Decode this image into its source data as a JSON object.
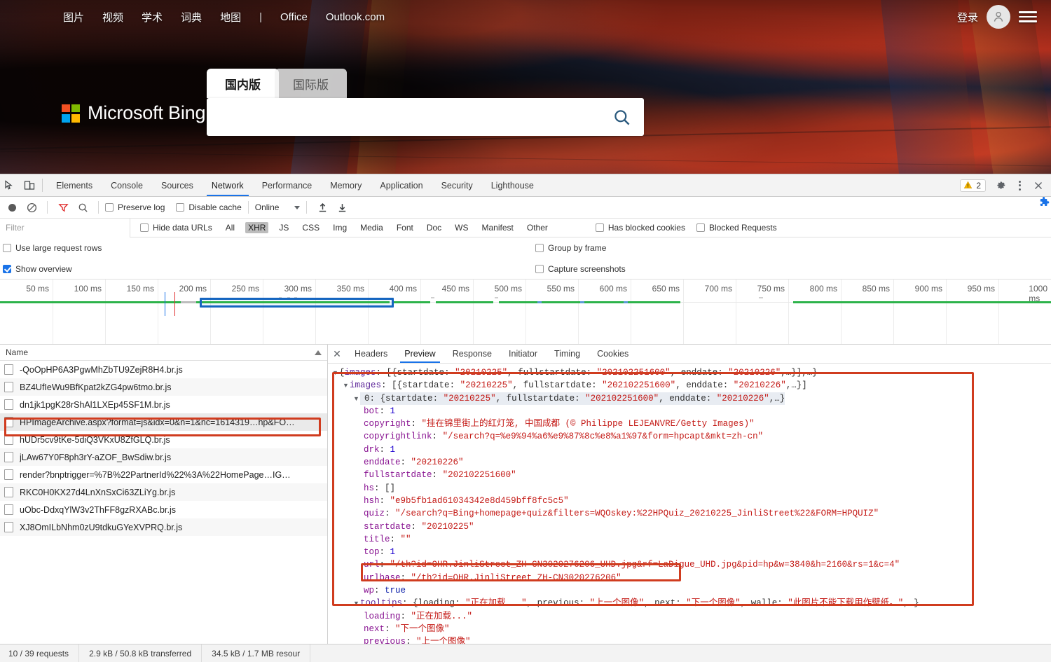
{
  "bing": {
    "nav_items": [
      "图片",
      "视频",
      "学术",
      "词典",
      "地图"
    ],
    "nav_separator": "|",
    "nav_office": "Office",
    "nav_outlook": "Outlook.com",
    "signin_label": "登录",
    "logo_text": "Microsoft Bing",
    "logo_colors": [
      "#f25022",
      "#7fba00",
      "#00a4ef",
      "#ffb900"
    ],
    "tabs": [
      {
        "label": "国内版",
        "active": true
      },
      {
        "label": "国际版",
        "active": false
      }
    ],
    "search_value": "",
    "search_placeholder": "",
    "search_icon": "search-icon"
  },
  "devtools": {
    "panels": [
      "Elements",
      "Console",
      "Sources",
      "Network",
      "Performance",
      "Memory",
      "Application",
      "Security",
      "Lighthouse"
    ],
    "active_panel": "Network",
    "warning_count": "2",
    "toolbar": {
      "preserve_log": {
        "label": "Preserve log",
        "checked": false
      },
      "disable_cache": {
        "label": "Disable cache",
        "checked": false
      },
      "throttle_value": "Online"
    },
    "filter": {
      "placeholder": "Filter",
      "value": "",
      "hide_data_urls": {
        "label": "Hide data URLs",
        "checked": false
      },
      "types": [
        "All",
        "XHR",
        "JS",
        "CSS",
        "Img",
        "Media",
        "Font",
        "Doc",
        "WS",
        "Manifest",
        "Other"
      ],
      "selected_type": "XHR",
      "has_blocked_cookies": {
        "label": "Has blocked cookies",
        "checked": false
      },
      "blocked_requests": {
        "label": "Blocked Requests",
        "checked": false
      }
    },
    "options": {
      "use_large_request_rows": {
        "label": "Use large request rows",
        "checked": false
      },
      "show_overview": {
        "label": "Show overview",
        "checked": true
      },
      "group_by_frame": {
        "label": "Group by frame",
        "checked": false
      },
      "capture_screenshots": {
        "label": "Capture screenshots",
        "checked": false
      }
    },
    "overview": {
      "ticks": [
        "50 ms",
        "100 ms",
        "150 ms",
        "200 ms",
        "250 ms",
        "300 ms",
        "350 ms",
        "400 ms",
        "450 ms",
        "500 ms",
        "550 ms",
        "600 ms",
        "650 ms",
        "700 ms",
        "750 ms",
        "800 ms",
        "850 ms",
        "900 ms",
        "950 ms",
        "1000 ms"
      ],
      "selection_start_ms": 205,
      "selection_end_ms": 405
    },
    "requests": {
      "column_header": "Name",
      "rows": [
        {
          "name": "-QoOpHP6A3PgwMhZbTU9ZejR8H4.br.js",
          "selected": false
        },
        {
          "name": "BZ4UfIeWu9BfKpat2kZG4pw6tmo.br.js",
          "selected": false
        },
        {
          "name": "dn1jk1pgK28rShAl1LXEp45SF1M.br.js",
          "selected": false
        },
        {
          "name": "HPImageArchive.aspx?format=js&idx=0&n=1&nc=1614319…hp&FO…",
          "selected": true
        },
        {
          "name": "hUDr5cv9tKe-5diQ3VKxU8ZfGLQ.br.js",
          "selected": false
        },
        {
          "name": "jLAw67Y0F8ph3rY-aZOF_BwSdiw.br.js",
          "selected": false
        },
        {
          "name": "render?bnptrigger=%7B%22PartnerId%22%3A%22HomePage…IG…",
          "selected": false
        },
        {
          "name": "RKC0H0KX27d4LnXnSxCi63ZLiYg.br.js",
          "selected": false
        },
        {
          "name": "uObc-DdxqYlW3v2ThFF8gzRXABc.br.js",
          "selected": false
        },
        {
          "name": "XJ8OmILbNhm0zU9tdkuGYeXVPRQ.br.js",
          "selected": false
        }
      ]
    },
    "detail": {
      "tabs": [
        "Headers",
        "Preview",
        "Response",
        "Initiator",
        "Timing",
        "Cookies"
      ],
      "active_tab": "Preview",
      "close_icon": "close-icon"
    },
    "statusbar": {
      "requests": "10 / 39 requests",
      "transferred": "2.9 kB / 50.8 kB transferred",
      "resources": "34.5 kB / 1.7 MB resour"
    },
    "highlight_color": "#d03c1f"
  },
  "preview_json": {
    "lines": [
      {
        "indent": 0,
        "tri": "▼",
        "parts": [
          {
            "t": "{",
            "c": "p"
          },
          {
            "t": "images",
            "c": "k2"
          },
          {
            "t": ": [{",
            "c": "p"
          },
          {
            "t": "startdate",
            "c": "p"
          },
          {
            "t": ": ",
            "c": "p"
          },
          {
            "t": "\"20210225\"",
            "c": "s"
          },
          {
            "t": ", ",
            "c": "p"
          },
          {
            "t": "fullstartdate",
            "c": "p"
          },
          {
            "t": ": ",
            "c": "p"
          },
          {
            "t": "\"202102251600\"",
            "c": "s"
          },
          {
            "t": ", ",
            "c": "p"
          },
          {
            "t": "enddate",
            "c": "p"
          },
          {
            "t": ": ",
            "c": "p"
          },
          {
            "t": "\"20210226\"",
            "c": "s"
          },
          {
            "t": ",…}],…}",
            "c": "p"
          }
        ]
      },
      {
        "indent": 1,
        "tri": "▼",
        "parts": [
          {
            "t": "images",
            "c": "k2"
          },
          {
            "t": ": [{",
            "c": "p"
          },
          {
            "t": "startdate",
            "c": "p"
          },
          {
            "t": ": ",
            "c": "p"
          },
          {
            "t": "\"20210225\"",
            "c": "s"
          },
          {
            "t": ", ",
            "c": "p"
          },
          {
            "t": "fullstartdate",
            "c": "p"
          },
          {
            "t": ": ",
            "c": "p"
          },
          {
            "t": "\"202102251600\"",
            "c": "s"
          },
          {
            "t": ", ",
            "c": "p"
          },
          {
            "t": "enddate",
            "c": "p"
          },
          {
            "t": ": ",
            "c": "p"
          },
          {
            "t": "\"20210226\"",
            "c": "s"
          },
          {
            "t": ",…}]",
            "c": "p"
          }
        ]
      },
      {
        "indent": 2,
        "tri": "▼",
        "hl": true,
        "parts": [
          {
            "t": "0",
            "c": "p"
          },
          {
            "t": ": {",
            "c": "p"
          },
          {
            "t": "startdate",
            "c": "p"
          },
          {
            "t": ": ",
            "c": "p"
          },
          {
            "t": "\"20210225\"",
            "c": "s"
          },
          {
            "t": ", ",
            "c": "p"
          },
          {
            "t": "fullstartdate",
            "c": "p"
          },
          {
            "t": ": ",
            "c": "p"
          },
          {
            "t": "\"202102251600\"",
            "c": "s"
          },
          {
            "t": ", ",
            "c": "p"
          },
          {
            "t": "enddate",
            "c": "p"
          },
          {
            "t": ": ",
            "c": "p"
          },
          {
            "t": "\"20210226\"",
            "c": "s"
          },
          {
            "t": ",…}",
            "c": "p"
          }
        ]
      },
      {
        "indent": 3,
        "parts": [
          {
            "t": "bot",
            "c": "k"
          },
          {
            "t": ": ",
            "c": "p"
          },
          {
            "t": "1",
            "c": "n"
          }
        ]
      },
      {
        "indent": 3,
        "parts": [
          {
            "t": "copyright",
            "c": "k"
          },
          {
            "t": ": ",
            "c": "p"
          },
          {
            "t": "\"挂在锦里街上的红灯笼, 中国成都 (© Philippe LEJEANVRE/Getty Images)\"",
            "c": "s"
          }
        ]
      },
      {
        "indent": 3,
        "parts": [
          {
            "t": "copyrightlink",
            "c": "k"
          },
          {
            "t": ": ",
            "c": "p"
          },
          {
            "t": "\"/search?q=%e9%94%a6%e9%87%8c%e8%a1%97&form=hpcapt&mkt=zh-cn\"",
            "c": "s"
          }
        ]
      },
      {
        "indent": 3,
        "parts": [
          {
            "t": "drk",
            "c": "k"
          },
          {
            "t": ": ",
            "c": "p"
          },
          {
            "t": "1",
            "c": "n"
          }
        ]
      },
      {
        "indent": 3,
        "parts": [
          {
            "t": "enddate",
            "c": "k"
          },
          {
            "t": ": ",
            "c": "p"
          },
          {
            "t": "\"20210226\"",
            "c": "s"
          }
        ]
      },
      {
        "indent": 3,
        "parts": [
          {
            "t": "fullstartdate",
            "c": "k"
          },
          {
            "t": ": ",
            "c": "p"
          },
          {
            "t": "\"202102251600\"",
            "c": "s"
          }
        ]
      },
      {
        "indent": 3,
        "parts": [
          {
            "t": "hs",
            "c": "k"
          },
          {
            "t": ": []",
            "c": "p"
          }
        ]
      },
      {
        "indent": 3,
        "parts": [
          {
            "t": "hsh",
            "c": "k"
          },
          {
            "t": ": ",
            "c": "p"
          },
          {
            "t": "\"e9b5fb1ad61034342e8d459bff8fc5c5\"",
            "c": "s"
          }
        ]
      },
      {
        "indent": 3,
        "parts": [
          {
            "t": "quiz",
            "c": "k"
          },
          {
            "t": ": ",
            "c": "p"
          },
          {
            "t": "\"/search?q=Bing+homepage+quiz&filters=WQOskey:%22HPQuiz_20210225_JinliStreet%22&FORM=HPQUIZ\"",
            "c": "s"
          }
        ]
      },
      {
        "indent": 3,
        "parts": [
          {
            "t": "startdate",
            "c": "k"
          },
          {
            "t": ": ",
            "c": "p"
          },
          {
            "t": "\"20210225\"",
            "c": "s"
          }
        ]
      },
      {
        "indent": 3,
        "parts": [
          {
            "t": "title",
            "c": "k"
          },
          {
            "t": ": ",
            "c": "p"
          },
          {
            "t": "\"\"",
            "c": "s"
          }
        ]
      },
      {
        "indent": 3,
        "parts": [
          {
            "t": "top",
            "c": "k"
          },
          {
            "t": ": ",
            "c": "p"
          },
          {
            "t": "1",
            "c": "n"
          }
        ]
      },
      {
        "indent": 3,
        "box": true,
        "parts": [
          {
            "t": "url",
            "c": "k"
          },
          {
            "t": ": ",
            "c": "p"
          },
          {
            "t": "\"/th?id=OHR.JinliStreet_ZH-CN3020276206_UHD.jpg&rf=LaDigue_UHD.jpg&pid=hp&w=3840&h=2160&rs=1&c=4\"",
            "c": "s"
          }
        ]
      },
      {
        "indent": 3,
        "parts": [
          {
            "t": "urlbase",
            "c": "k"
          },
          {
            "t": ": ",
            "c": "p"
          },
          {
            "t": "\"/th?id=OHR.JinliStreet_ZH-CN3020276206\"",
            "c": "s"
          }
        ]
      },
      {
        "indent": 3,
        "parts": [
          {
            "t": "wp",
            "c": "k"
          },
          {
            "t": ": ",
            "c": "p"
          },
          {
            "t": "true",
            "c": "b"
          }
        ]
      },
      {
        "indent": 2,
        "tri": "▼",
        "parts": [
          {
            "t": "tooltips",
            "c": "k2"
          },
          {
            "t": ": {",
            "c": "p"
          },
          {
            "t": "loading",
            "c": "p"
          },
          {
            "t": ": ",
            "c": "p"
          },
          {
            "t": "\"正在加载...\"",
            "c": "s"
          },
          {
            "t": ", ",
            "c": "p"
          },
          {
            "t": "previous",
            "c": "p"
          },
          {
            "t": ": ",
            "c": "p"
          },
          {
            "t": "\"上一个图像\"",
            "c": "s"
          },
          {
            "t": ", ",
            "c": "p"
          },
          {
            "t": "next",
            "c": "p"
          },
          {
            "t": ": ",
            "c": "p"
          },
          {
            "t": "\"下一个图像\"",
            "c": "s"
          },
          {
            "t": ", ",
            "c": "p"
          },
          {
            "t": "walle",
            "c": "p"
          },
          {
            "t": ": ",
            "c": "p"
          },
          {
            "t": "\"此图片不能下载用作壁纸。\"",
            "c": "s"
          },
          {
            "t": ",…}",
            "c": "p"
          }
        ]
      },
      {
        "indent": 3,
        "parts": [
          {
            "t": "loading",
            "c": "k"
          },
          {
            "t": ": ",
            "c": "p"
          },
          {
            "t": "\"正在加载...\"",
            "c": "s"
          }
        ]
      },
      {
        "indent": 3,
        "parts": [
          {
            "t": "next",
            "c": "k"
          },
          {
            "t": ": ",
            "c": "p"
          },
          {
            "t": "\"下一个图像\"",
            "c": "s"
          }
        ]
      },
      {
        "indent": 3,
        "parts": [
          {
            "t": "previous",
            "c": "k"
          },
          {
            "t": ": ",
            "c": "p"
          },
          {
            "t": "\"上一个图像\"",
            "c": "s"
          }
        ]
      },
      {
        "indent": 3,
        "parts": [
          {
            "t": "walle",
            "c": "k"
          },
          {
            "t": ": ",
            "c": "p"
          },
          {
            "t": "\"此图片不能下载用作壁纸。\"",
            "c": "s"
          }
        ]
      }
    ]
  }
}
